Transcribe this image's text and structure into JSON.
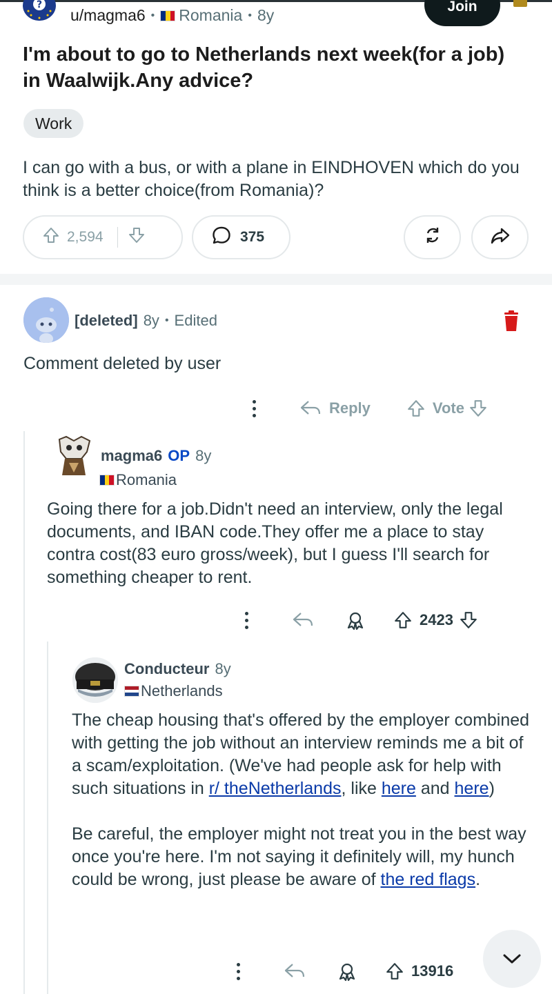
{
  "post": {
    "author": "u/magma6",
    "flag_label": "Romania",
    "age": "8y",
    "join_label": "Join",
    "title": "I'm about to go to Netherlands next week(for a job) in Waalwijk.Any advice?",
    "flair": "Work",
    "body": "I can go with a bus, or with a plane in EINDHOVEN which do you think is a better choice(from Romania)?",
    "upvotes": "2,594",
    "comments": "375"
  },
  "colors": {
    "romania_flag": [
      "#002b7f",
      "#fcd116",
      "#ce1126"
    ],
    "netherlands_flag": [
      "#ae1c28",
      "#ffffff",
      "#21468b"
    ],
    "op_tag": "#0a49c6",
    "link": "#0a3aa8"
  },
  "comments": [
    {
      "author": "[deleted]",
      "age": "8y",
      "edited": "Edited",
      "body": "Comment deleted by user",
      "reply_label": "Reply",
      "vote_label": "Vote"
    },
    {
      "author": "magma6",
      "op_tag": "OP",
      "age": "8y",
      "flair": "Romania",
      "body": "Going there for a job.Didn't need an interview, only the legal documents, and IBAN code.They offer me a place to stay contra cost(83 euro gross/week), but I guess I'll search for something cheaper to rent.",
      "score": "2423"
    },
    {
      "author": "Conducteur",
      "age": "8y",
      "flair": "Netherlands",
      "body_p1_a": "The cheap housing that's offered by the employer combined with getting the job without an interview reminds me a bit of a scam/exploitation. (We've had people ask for help with such situations in ",
      "link_sub": "r/ theNetherlands",
      "body_p1_b": ", like ",
      "link_here1": "here",
      "body_p1_c": " and ",
      "link_here2": "here",
      "body_p1_d": ")",
      "body_p2_a": "Be careful, the employer might not treat you in the best way once you're here. I'm not saying it definitely will, my hunch could be wrong, just please be aware of ",
      "link_flags": "the red flags",
      "body_p2_b": ".",
      "score": "13916"
    }
  ]
}
